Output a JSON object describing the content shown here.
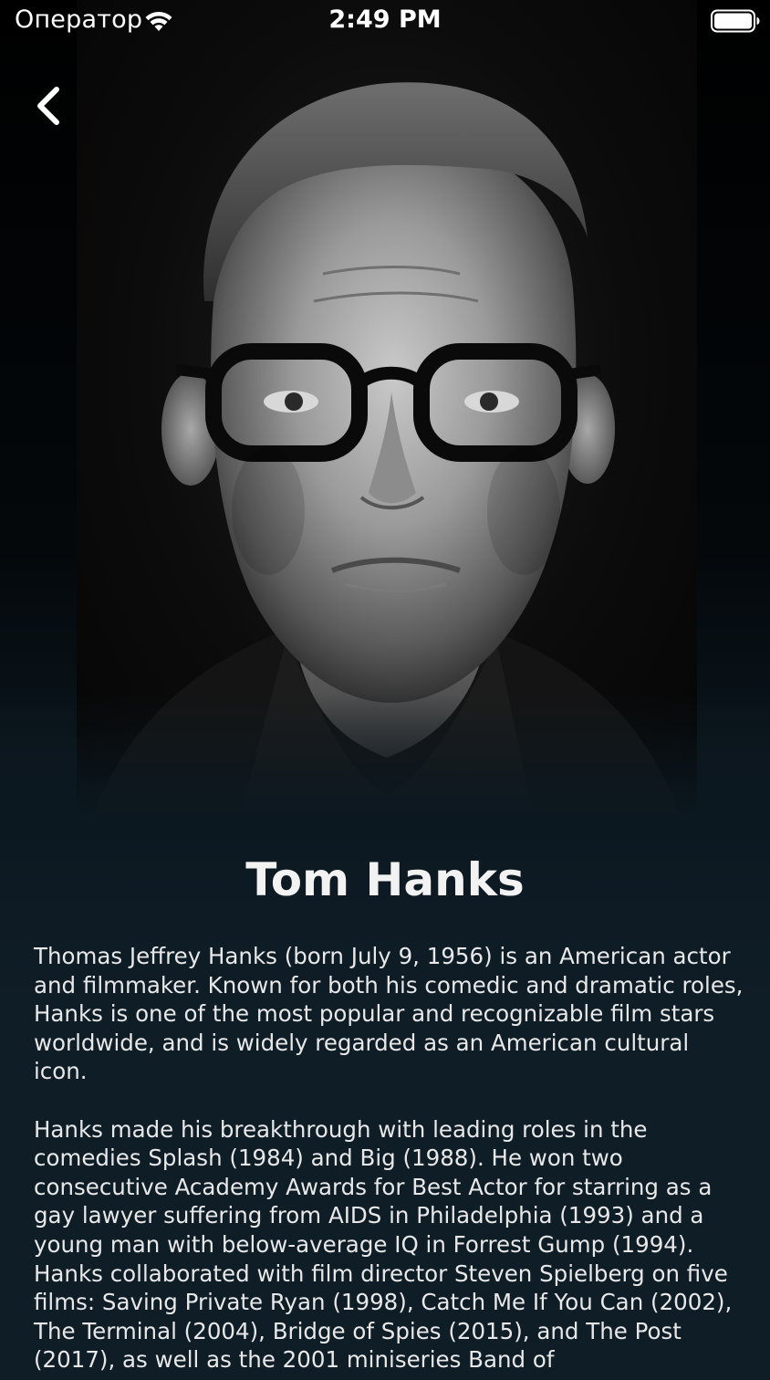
{
  "status_bar": {
    "carrier": "Оператор",
    "time": "2:49 PM",
    "wifi_icon": "wifi-icon",
    "battery_icon": "battery-icon"
  },
  "navigation": {
    "back_icon": "chevron-left-icon"
  },
  "person": {
    "name": "Tom Hanks",
    "photo_icon": "portrait-photo",
    "bio_paragraphs": [
      "Thomas Jeffrey Hanks (born July 9, 1956) is an American actor and filmmaker. Known for both his comedic and dramatic roles, Hanks is one of the most popular and recognizable film stars worldwide, and is widely regarded as an American cultural icon.",
      "Hanks made his breakthrough with leading roles in the comedies Splash (1984) and Big (1988). He won two consecutive Academy Awards for Best Actor for starring as a gay lawyer suffering from AIDS in Philadelphia (1993) and a young man with below-average IQ in Forrest Gump (1994). Hanks collaborated with film director Steven Spielberg on five films: Saving Private Ryan (1998), Catch Me If You Can (2002), The Terminal (2004), Bridge of Spies (2015), and The Post (2017), as well as the 2001 miniseries Band of"
    ]
  },
  "colors": {
    "background": "#0f1d27",
    "text": "#e8e8e8",
    "title": "#f2f2f2"
  }
}
